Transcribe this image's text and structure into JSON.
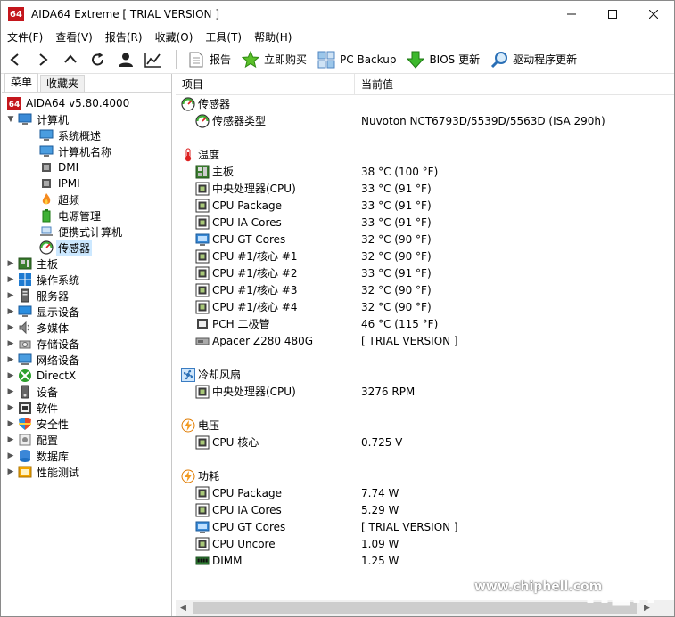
{
  "window": {
    "title": "AIDA64 Extreme  [ TRIAL VERSION ]",
    "logo_text": "64"
  },
  "menu": [
    "文件(F)",
    "查看(V)",
    "报告(R)",
    "收藏(O)",
    "工具(T)",
    "帮助(H)"
  ],
  "toolbar": {
    "report": "报告",
    "buy": "立即购买",
    "backup": "PC Backup",
    "bios": "BIOS 更新",
    "driver": "驱动程序更新"
  },
  "tabs": {
    "menu": "菜单",
    "favorites": "收藏夹"
  },
  "tree": {
    "root": "AIDA64 v5.80.4000",
    "computer": "计算机",
    "computer_children": [
      "系统概述",
      "计算机名称",
      "DMI",
      "IPMI",
      "超频",
      "电源管理",
      "便携式计算机",
      "传感器"
    ],
    "groups": [
      "主板",
      "操作系统",
      "服务器",
      "显示设备",
      "多媒体",
      "存储设备",
      "网络设备",
      "DirectX",
      "设备",
      "软件",
      "安全性",
      "配置",
      "数据库",
      "性能测试"
    ]
  },
  "columns": {
    "item": "项目",
    "value": "当前值"
  },
  "sections": {
    "sensor": {
      "title": "传感器",
      "rows": [
        {
          "name": "传感器类型",
          "value": "Nuvoton NCT6793D/5539D/5563D  (ISA 290h)"
        }
      ]
    },
    "temperature": {
      "title": "温度",
      "rows": [
        {
          "name": "主板",
          "value": "38 °C  (100 °F)"
        },
        {
          "name": "中央处理器(CPU)",
          "value": "33 °C  (91 °F)"
        },
        {
          "name": "CPU Package",
          "value": "33 °C  (91 °F)"
        },
        {
          "name": "CPU IA Cores",
          "value": "33 °C  (91 °F)"
        },
        {
          "name": "CPU GT Cores",
          "value": "32 °C  (90 °F)"
        },
        {
          "name": "CPU #1/核心 #1",
          "value": "32 °C  (90 °F)"
        },
        {
          "name": "CPU #1/核心 #2",
          "value": "33 °C  (91 °F)"
        },
        {
          "name": "CPU #1/核心 #3",
          "value": "32 °C  (90 °F)"
        },
        {
          "name": "CPU #1/核心 #4",
          "value": "32 °C  (90 °F)"
        },
        {
          "name": "PCH 二极管",
          "value": "46 °C  (115 °F)"
        },
        {
          "name": "Apacer Z280 480G",
          "value": "[ TRIAL VERSION ]"
        }
      ]
    },
    "fan": {
      "title": "冷却风扇",
      "rows": [
        {
          "name": "中央处理器(CPU)",
          "value": "3276 RPM"
        }
      ]
    },
    "voltage": {
      "title": "电压",
      "rows": [
        {
          "name": "CPU 核心",
          "value": "0.725 V"
        }
      ]
    },
    "power": {
      "title": "功耗",
      "rows": [
        {
          "name": "CPU Package",
          "value": "7.74 W"
        },
        {
          "name": "CPU IA Cores",
          "value": "5.29 W"
        },
        {
          "name": "CPU GT Cores",
          "value": "[ TRIAL VERSION ]"
        },
        {
          "name": "CPU Uncore",
          "value": "1.09 W"
        },
        {
          "name": "DIMM",
          "value": "1.25 W"
        }
      ]
    }
  },
  "watermark": {
    "url": "www.chiphell.com"
  },
  "colors": {
    "selection": "#cce8ff",
    "logo_red": "#c4161c"
  }
}
